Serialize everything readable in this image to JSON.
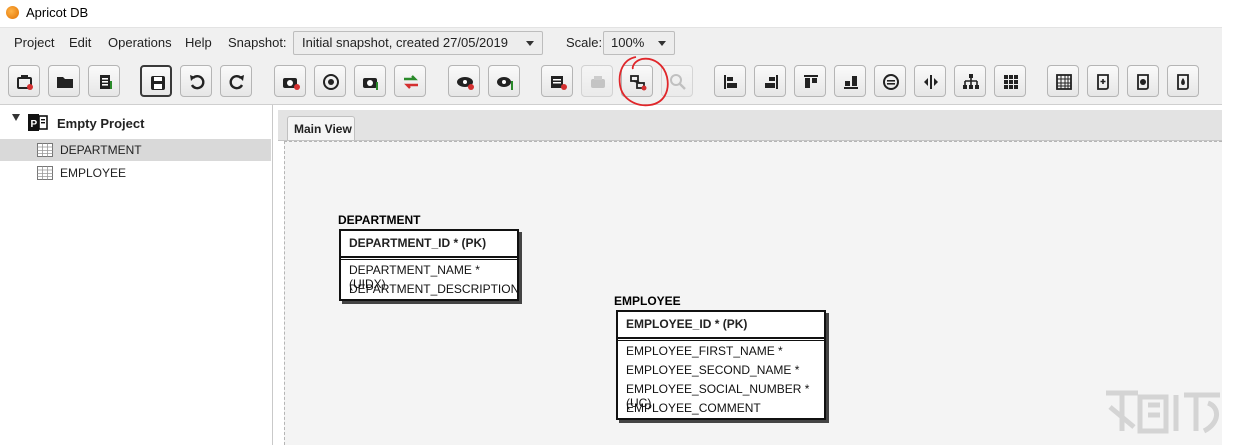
{
  "window": {
    "title": "Apricot DB"
  },
  "menu": {
    "items": [
      "Project",
      "Edit",
      "Operations",
      "Help"
    ],
    "snapshot_label": "Snapshot:",
    "snapshot_value": "Initial snapshot, created 27/05/2019",
    "scale_label": "Scale:",
    "scale_value": "100%"
  },
  "toolbar": {
    "buttons": [
      "new-project-icon",
      "open-folder-icon",
      "clipboard-icon",
      "save-icon",
      "undo-icon",
      "redo-icon",
      "camera-add-icon",
      "compare-snapshot-icon",
      "camera-edit-icon",
      "swap-arrows-icon",
      "view-icon",
      "view-edit-icon",
      "add-table-icon",
      "delete-table-icon",
      "add-relationship-icon",
      "zoom-icon",
      "align-left-icon",
      "align-right-icon",
      "align-top-icon",
      "align-bottom-icon",
      "center-icon",
      "distribute-horizontal-icon",
      "hierarchy-icon",
      "grid-icon",
      "spreadsheet-icon",
      "script-add-icon",
      "script-view-icon",
      "script-run-icon"
    ],
    "annotation_color": "#e0262a"
  },
  "project_tree": {
    "project_name": "Empty Project",
    "items": [
      {
        "label": "DEPARTMENT",
        "selected": true
      },
      {
        "label": "EMPLOYEE",
        "selected": false
      }
    ]
  },
  "editor": {
    "tab_label": "Main View",
    "entities": [
      {
        "name": "DEPARTMENT",
        "pk": "DEPARTMENT_ID * (PK)",
        "columns": [
          "DEPARTMENT_NAME * (UIDX)",
          "DEPARTMENT_DESCRIPTION"
        ]
      },
      {
        "name": "EMPLOYEE",
        "pk": "EMPLOYEE_ID * (PK)",
        "columns": [
          "EMPLOYEE_FIRST_NAME *",
          "EMPLOYEE_SECOND_NAME *",
          "EMPLOYEE_SOCIAL_NUMBER * (UC)",
          "EMPLOYEE_COMMENT"
        ]
      }
    ]
  }
}
